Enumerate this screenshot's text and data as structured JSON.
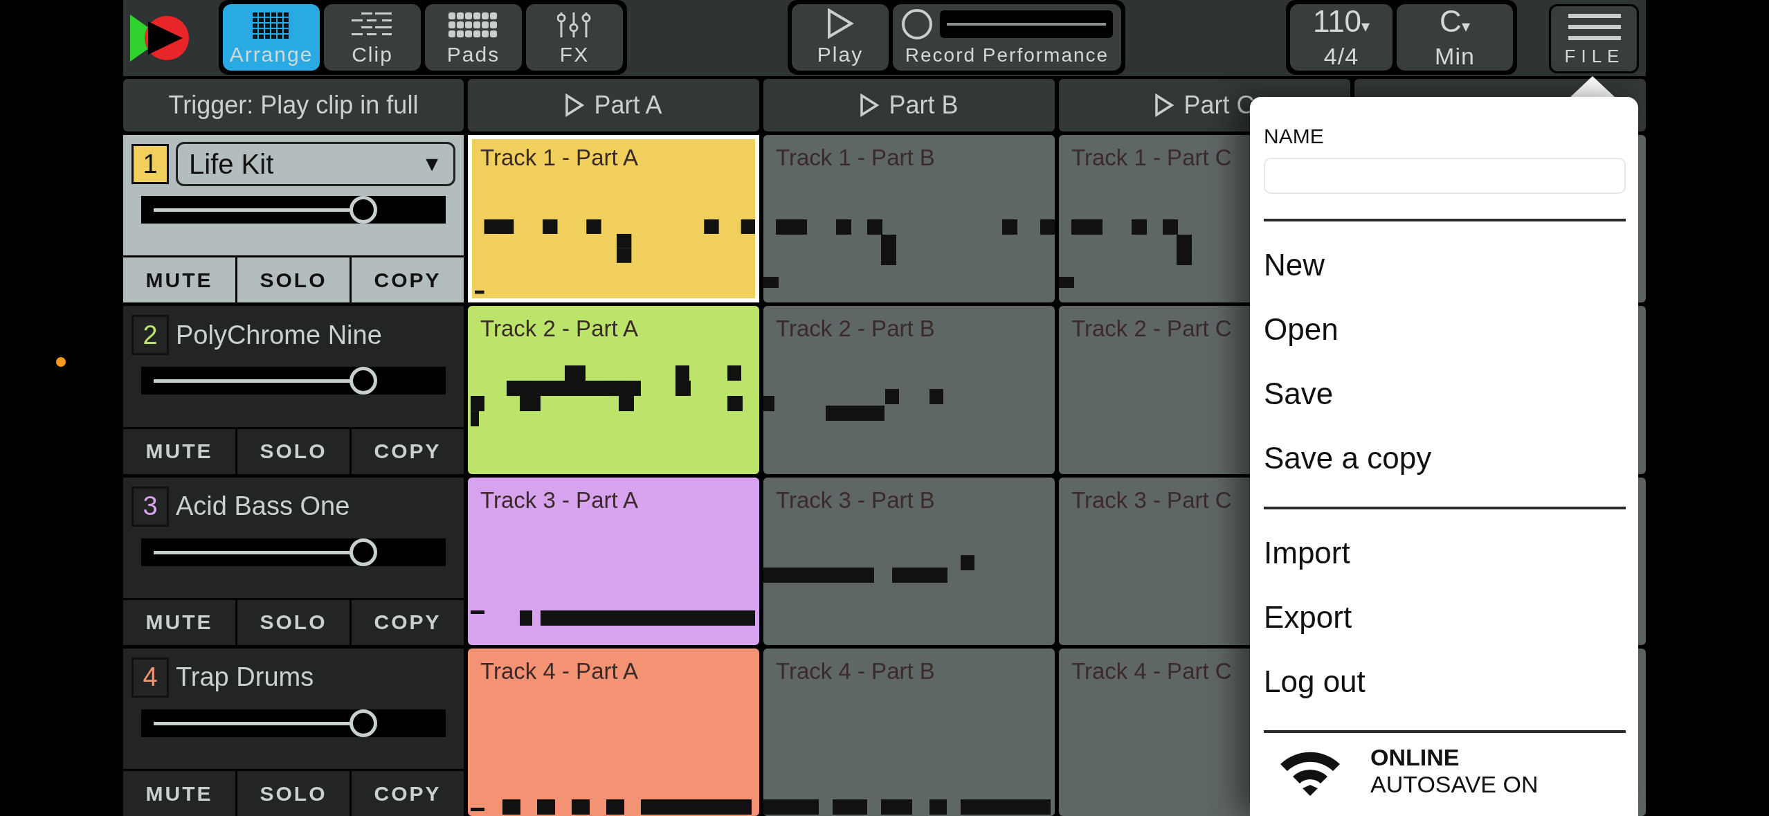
{
  "toolbar": {
    "views": [
      {
        "kind": "arrange",
        "label": "Arrange",
        "selected": true
      },
      {
        "kind": "clip",
        "label": "Clip",
        "selected": false
      },
      {
        "kind": "pads",
        "label": "Pads",
        "selected": false
      },
      {
        "kind": "fx",
        "label": "FX",
        "selected": false
      }
    ],
    "transport": [
      {
        "kind": "play",
        "label": "Play"
      },
      {
        "kind": "record",
        "label": "Record Performance"
      }
    ],
    "tempo": {
      "value": "110",
      "caret": "▾",
      "meter": "4/4"
    },
    "key": {
      "value": "C",
      "caret": "▾",
      "scale": "Min"
    },
    "file_button": "FILE"
  },
  "trigger": "Trigger: Play clip in full",
  "parts": [
    "Part A",
    "Part B",
    "Part C"
  ],
  "tracks": [
    {
      "number": "1",
      "name": "Life Kit",
      "caret": "▼",
      "color": "#f0cf5c",
      "selected": true,
      "level": 0.73,
      "buttons": [
        "MUTE",
        "SOLO",
        "COPY"
      ],
      "clips": [
        {
          "label": "Track 1 - Part A",
          "active": true,
          "selected": true
        },
        {
          "label": "Track 1 - Part B",
          "active": false,
          "selected": false
        },
        {
          "label": "Track 1 - Part C",
          "active": false,
          "selected": false
        }
      ]
    },
    {
      "number": "2",
      "name": "PolyChrome Nine",
      "color": "#bce46a",
      "selected": false,
      "level": 0.73,
      "buttons": [
        "MUTE",
        "SOLO",
        "COPY"
      ],
      "clips": [
        {
          "label": "Track 2 - Part A",
          "active": true,
          "selected": false
        },
        {
          "label": "Track 2 - Part B",
          "active": false,
          "selected": false
        },
        {
          "label": "Track 2 - Part C",
          "active": false,
          "selected": false
        }
      ]
    },
    {
      "number": "3",
      "name": "Acid Bass One",
      "color": "#d7a3ee",
      "selected": false,
      "level": 0.73,
      "buttons": [
        "MUTE",
        "SOLO",
        "COPY"
      ],
      "clips": [
        {
          "label": "Track 3 - Part A",
          "active": true,
          "selected": false
        },
        {
          "label": "Track 3 - Part B",
          "active": false,
          "selected": false
        },
        {
          "label": "Track 3 - Part C",
          "active": false,
          "selected": false
        }
      ]
    },
    {
      "number": "4",
      "name": "Trap Drums",
      "color": "#f49374",
      "selected": false,
      "level": 0.73,
      "buttons": [
        "MUTE",
        "SOLO",
        "COPY"
      ],
      "clips": [
        {
          "label": "Track 4 - Part A",
          "active": true,
          "selected": false
        },
        {
          "label": "Track 4 - Part B",
          "active": false,
          "selected": false
        },
        {
          "label": "Track 4 - Part C",
          "active": false,
          "selected": false
        }
      ]
    }
  ],
  "file_menu": {
    "name_label": "NAME",
    "groups": [
      [
        "New",
        "Open",
        "Save",
        "Save a copy"
      ],
      [
        "Import",
        "Export",
        "Log out"
      ]
    ],
    "status": {
      "online": "ONLINE",
      "autosave": "AUTOSAVE ON"
    }
  }
}
